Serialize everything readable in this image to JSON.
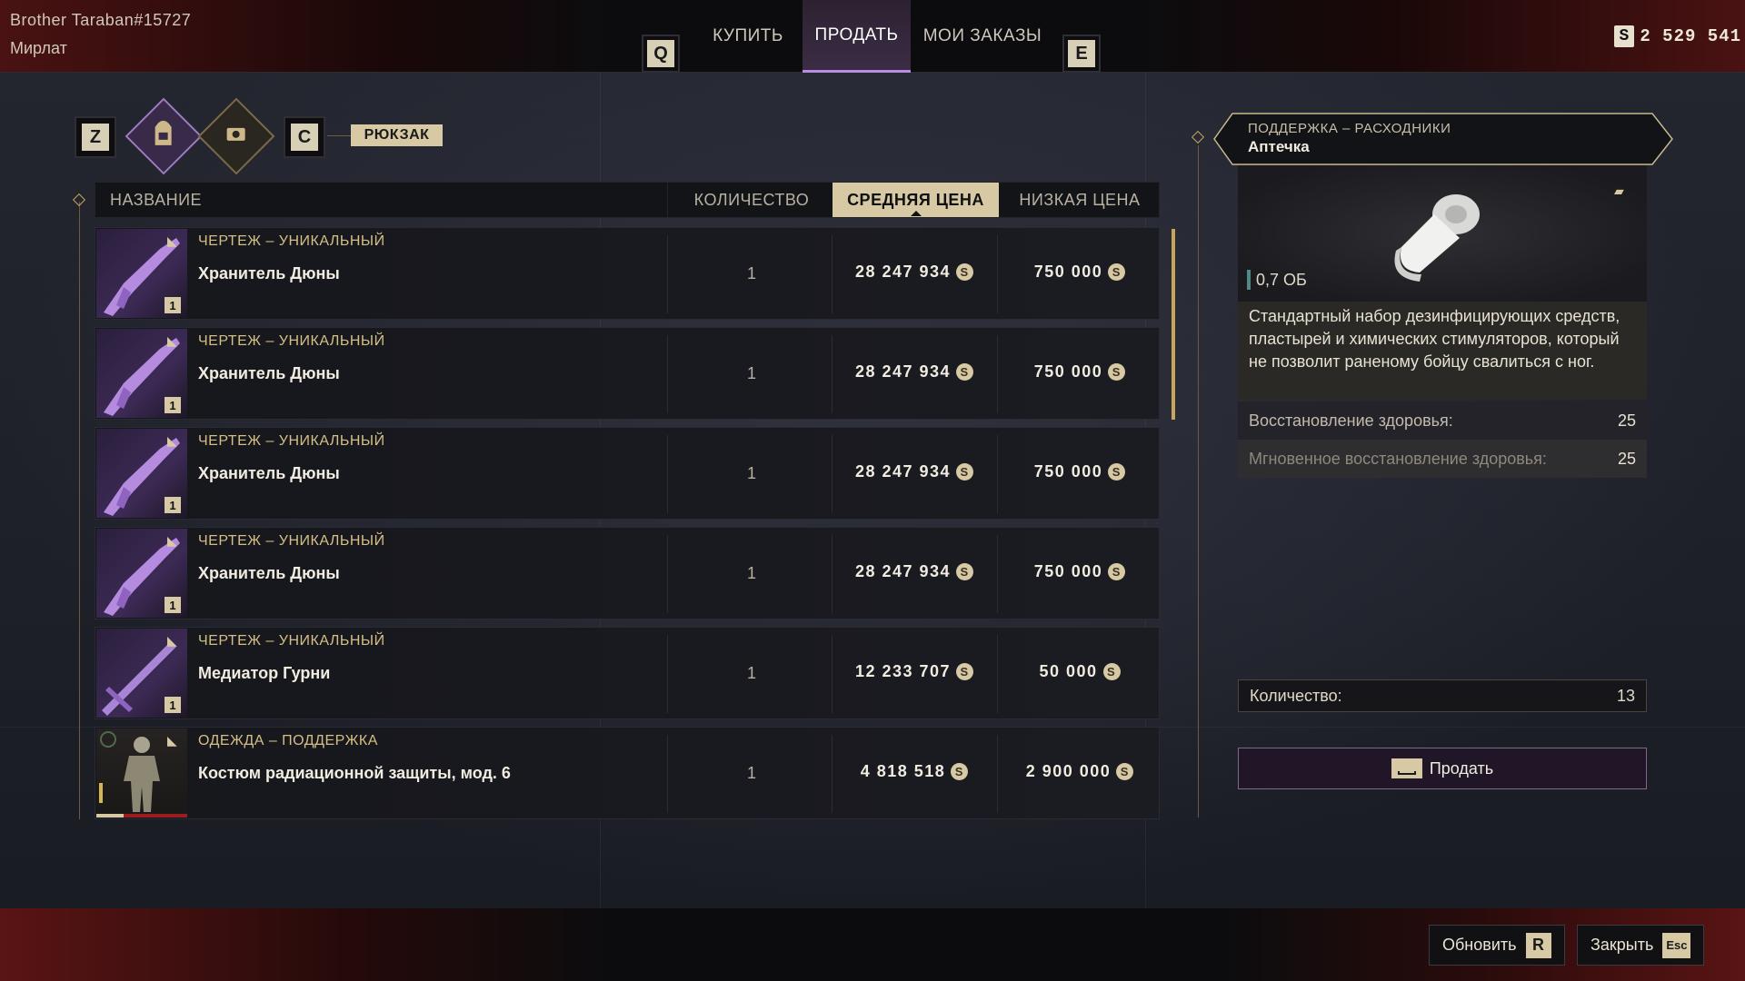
{
  "player": {
    "name": "Brother Taraban#15727",
    "location": "Мирлат"
  },
  "currency": {
    "icon": "solari-icon",
    "symbol": "S",
    "amount": "2 529 541"
  },
  "tabs": {
    "prev_key": "Q",
    "next_key": "E",
    "items": [
      {
        "label": "КУПИТЬ",
        "active": false
      },
      {
        "label": "ПРОДАТЬ",
        "active": true
      },
      {
        "label": "МОИ ЗАКАЗЫ",
        "active": false
      }
    ]
  },
  "filters": {
    "prev_key": "Z",
    "next_key": "C",
    "icons": [
      "backpack-icon",
      "vehicle-storage-icon"
    ],
    "active_label": "РЮКЗАК"
  },
  "table": {
    "headers": {
      "name": "НАЗВАНИЕ",
      "quantity": "КОЛИЧЕСТВО",
      "avg_price": "СРЕДНЯЯ ЦЕНА",
      "low_price": "НИЗКАЯ ЦЕНА"
    },
    "sorted_by": "avg_price",
    "coin_symbol": "S",
    "rows": [
      {
        "category": "ЧЕРТЕЖ – УНИКАЛЬНЫЙ",
        "name": "Хранитель Дюны",
        "quantity": "1",
        "avg_price": "28 247 934",
        "low_price": "750 000",
        "badge": "1",
        "thumb": "weapon-rifle-icon"
      },
      {
        "category": "ЧЕРТЕЖ – УНИКАЛЬНЫЙ",
        "name": "Хранитель Дюны",
        "quantity": "1",
        "avg_price": "28 247 934",
        "low_price": "750 000",
        "badge": "1",
        "thumb": "weapon-rifle-icon"
      },
      {
        "category": "ЧЕРТЕЖ – УНИКАЛЬНЫЙ",
        "name": "Хранитель Дюны",
        "quantity": "1",
        "avg_price": "28 247 934",
        "low_price": "750 000",
        "badge": "1",
        "thumb": "weapon-rifle-icon"
      },
      {
        "category": "ЧЕРТЕЖ – УНИКАЛЬНЫЙ",
        "name": "Хранитель Дюны",
        "quantity": "1",
        "avg_price": "28 247 934",
        "low_price": "750 000",
        "badge": "1",
        "thumb": "weapon-rifle-icon"
      },
      {
        "category": "ЧЕРТЕЖ – УНИКАЛЬНЫЙ",
        "name": "Медиатор Гурни",
        "quantity": "1",
        "avg_price": "12 233 707",
        "low_price": "50 000",
        "badge": "1",
        "thumb": "weapon-sword-icon"
      },
      {
        "category": "ОДЕЖДА – ПОДДЕРЖКА",
        "name": "Костюм радиационной защиты, мод. 6",
        "quantity": "1",
        "avg_price": "4 818 518",
        "low_price": "2 900 000",
        "badge": "",
        "thumb": "suit-icon"
      }
    ]
  },
  "detail": {
    "category": "ПОДДЕРЖКА – РАСХОДНИКИ",
    "name": "Аптечка",
    "image": "bandage-roll-icon",
    "volume": "0,7 ОБ",
    "description": "Стандартный набор дезинфицирующих средств, пластырей и химических стимуляторов, который не позволит раненому бойцу свалиться с ног.",
    "stats": [
      {
        "label": "Восстановление здоровья:",
        "value": "25"
      },
      {
        "label": "Мгновенное восстановление здоровья:",
        "value": "25"
      }
    ],
    "quantity_label": "Количество:",
    "quantity_value": "13",
    "sell_label": "Продать"
  },
  "footer": {
    "refresh_label": "Обновить",
    "refresh_key": "R",
    "close_label": "Закрыть",
    "close_key": "Esc"
  },
  "colors": {
    "accent_gold": "#d7c9a4",
    "active_tab": "#b98de0",
    "category_text": "#d6bf86",
    "frame_red": "#5a1414"
  }
}
